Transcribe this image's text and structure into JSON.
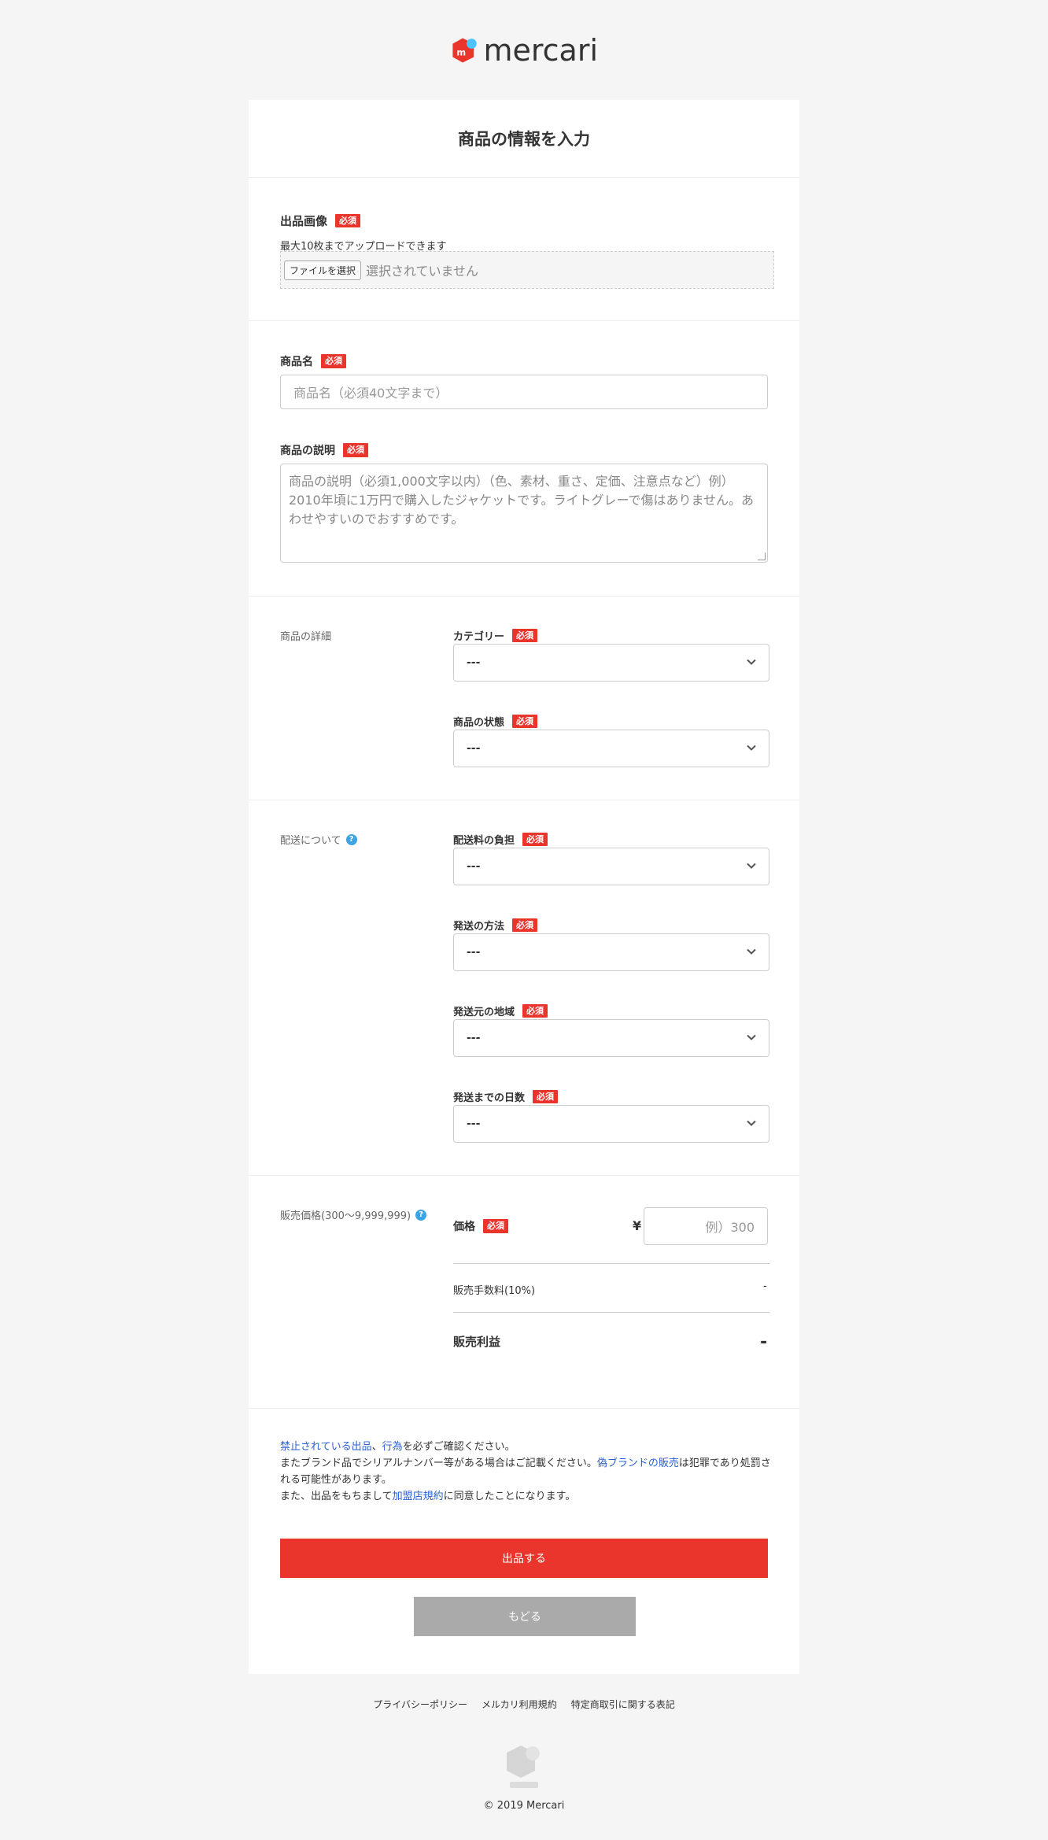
{
  "brand": {
    "name": "mercari",
    "accent": "#ea352d",
    "logo_bubble": "#4dc3ff"
  },
  "form_title": "商品の情報を入力",
  "required_badge": "必須",
  "image_section": {
    "label": "出品画像",
    "hint": "最大10枚までアップロードできます",
    "file_button": "ファイルを選択",
    "file_status": "選択されていません"
  },
  "name_field": {
    "label": "商品名",
    "placeholder": "商品名（必須40文字まで）"
  },
  "description_field": {
    "label": "商品の説明",
    "placeholder": "商品の説明（必須1,000文字以内）（色、素材、重さ、定価、注意点など）例）2010年頃に1万円で購入したジャケットです。ライトグレーで傷はありません。あわせやすいのでおすすめです。"
  },
  "details_section": {
    "label": "商品の詳細",
    "category": {
      "label": "カテゴリー",
      "value": "---"
    },
    "condition": {
      "label": "商品の状態",
      "value": "---"
    }
  },
  "shipping_section": {
    "label": "配送について",
    "help_icon": "question-circle-icon",
    "fee_burden": {
      "label": "配送料の負担",
      "value": "---"
    },
    "method": {
      "label": "発送の方法",
      "value": "---"
    },
    "origin": {
      "label": "発送元の地域",
      "value": "---"
    },
    "days": {
      "label": "発送までの日数",
      "value": "---"
    }
  },
  "price_section": {
    "label": "販売価格(300〜9,999,999)",
    "price_label": "価格",
    "currency": "¥",
    "price_placeholder": "例）300",
    "fee_label": "販売手数料(10%)",
    "fee_value": "-",
    "profit_label": "販売利益",
    "profit_value": "-"
  },
  "notice": {
    "line1_link1": "禁止されている出品",
    "line1_sep": "、",
    "line1_link2": "行為",
    "line1_rest": "を必ずご確認ください。",
    "line2_pre": "またブランド品でシリアルナンバー等がある場合はご記載ください。",
    "line2_link": "偽ブランドの販売",
    "line2_post": "は犯罪であり処罰される可能性があります。",
    "line3_pre": "また、出品をもちまして",
    "line3_link": "加盟店規約",
    "line3_post": "に同意したことになります。"
  },
  "buttons": {
    "submit": "出品する",
    "back": "もどる"
  },
  "footer": {
    "links": [
      "プライバシーポリシー",
      "メルカリ利用規約",
      "特定商取引に関する表記"
    ],
    "copyright": "© 2019 Mercari"
  }
}
